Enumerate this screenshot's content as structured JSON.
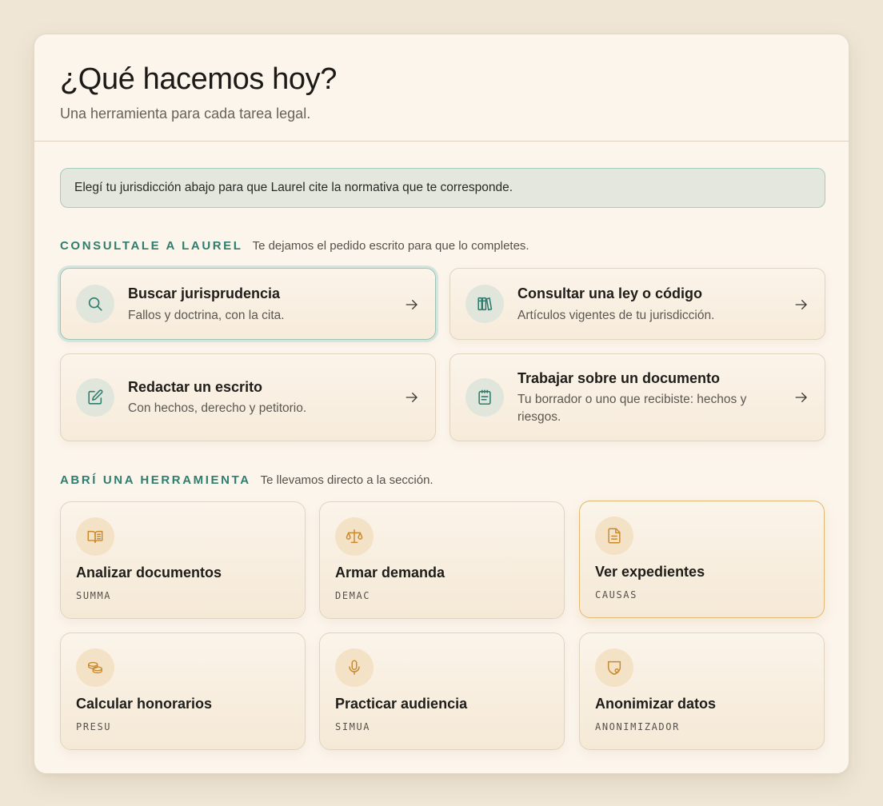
{
  "header": {
    "title": "¿Qué hacemos hoy?",
    "subtitle": "Una herramienta para cada tarea legal."
  },
  "notice": {
    "text": "Elegí tu jurisdicción abajo para que Laurel cite la normativa que te corresponde."
  },
  "ask_section": {
    "label": "CONSULTALE A LAUREL",
    "description": "Te dejamos el pedido escrito para que lo completes.",
    "items": [
      {
        "title": "Buscar jurisprudencia",
        "subtitle": "Fallos y doctrina, con la cita.",
        "icon": "search-icon"
      },
      {
        "title": "Consultar una ley o código",
        "subtitle": "Artículos vigentes de tu jurisdicción.",
        "icon": "books-icon"
      },
      {
        "title": "Redactar un escrito",
        "subtitle": "Con hechos, derecho y petitorio.",
        "icon": "pencil-icon"
      },
      {
        "title": "Trabajar sobre un documento",
        "subtitle": "Tu borrador o uno que recibiste: hechos y riesgos.",
        "icon": "notepad-icon"
      }
    ]
  },
  "tools_section": {
    "label": "ABRÍ UNA HERRAMIENTA",
    "description": "Te llevamos directo a la sección.",
    "items": [
      {
        "title": "Analizar documentos",
        "code": "SUMMA",
        "icon": "open-book-icon"
      },
      {
        "title": "Armar demanda",
        "code": "DEMAC",
        "icon": "scales-icon"
      },
      {
        "title": "Ver expedientes",
        "code": "CAUSAS",
        "icon": "document-icon"
      },
      {
        "title": "Calcular honorarios",
        "code": "PRESU",
        "icon": "coins-icon"
      },
      {
        "title": "Practicar audiencia",
        "code": "SIMUA",
        "icon": "microphone-icon"
      },
      {
        "title": "Anonimizar datos",
        "code": "ANONIMIZADOR",
        "icon": "shield-icon"
      }
    ]
  },
  "colors": {
    "background": "#efe6d6",
    "card": "#fcf5ec",
    "accent_teal": "#2e7d6e",
    "accent_amber": "#c98a2e",
    "notice_bg": "#e4e7de"
  }
}
